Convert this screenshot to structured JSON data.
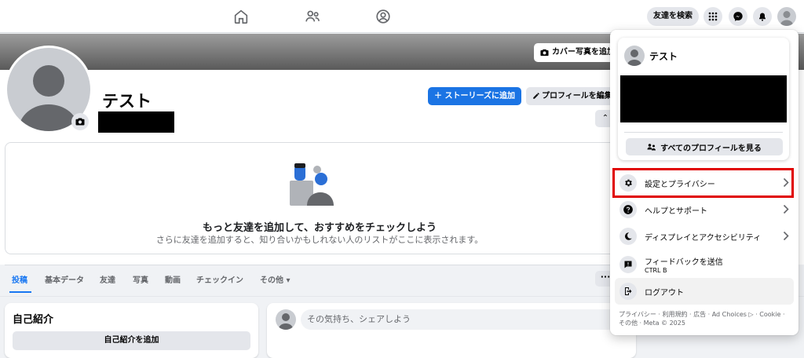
{
  "topbar": {
    "find_friends_label": "友達を検索",
    "icons": [
      "home-icon",
      "friends-icon",
      "profile-icon",
      "menu-grid-icon",
      "messenger-icon",
      "bell-icon",
      "account-avatar"
    ]
  },
  "profile": {
    "name": "テスト",
    "cover_button_label": "カバー写真を追加",
    "add_story_label": "＋ ストーリーズに追加",
    "edit_profile_label": "プロフィールを編集",
    "more_chevron": "⌃"
  },
  "suggestions": {
    "title": "もっと友達を追加して、おすすめをチェックしよう",
    "subtitle": "さらに友達を追加すると、知り合いかもしれない人のリストがここに表示されます。"
  },
  "tabs": [
    {
      "label": "投稿",
      "active": true
    },
    {
      "label": "基本データ",
      "active": false
    },
    {
      "label": "友達",
      "active": false
    },
    {
      "label": "写真",
      "active": false
    },
    {
      "label": "動画",
      "active": false
    },
    {
      "label": "チェックイン",
      "active": false
    },
    {
      "label": "その他 ▾",
      "active": false
    }
  ],
  "more_dots": "···",
  "intro": {
    "title": "自己紹介",
    "add_button_label": "自己紹介を追加"
  },
  "composer": {
    "placeholder": "その気持ち、シェアしよう"
  },
  "menu": {
    "profile_name": "テスト",
    "see_all_profiles_label": "すべてのプロフィールを見る",
    "items": [
      {
        "label": "設定とプライバシー",
        "icon": "gear-icon",
        "has_chevron": true,
        "highlighted": true
      },
      {
        "label": "ヘルプとサポート",
        "icon": "question-icon",
        "has_chevron": true
      },
      {
        "label": "ディスプレイとアクセシビリティ",
        "icon": "moon-icon",
        "has_chevron": true
      },
      {
        "label": "フィードバックを送信",
        "sublabel": "CTRL B",
        "icon": "feedback-icon",
        "has_chevron": false
      },
      {
        "label": "ログアウト",
        "icon": "logout-icon",
        "has_chevron": false
      }
    ],
    "footer": "プライバシー · 利用規約 · 広告 · Ad Choices ▷ · Cookie · その他 · Meta © 2025"
  },
  "colors": {
    "accent_blue": "#1877f2",
    "highlight_red": "#e00000"
  }
}
